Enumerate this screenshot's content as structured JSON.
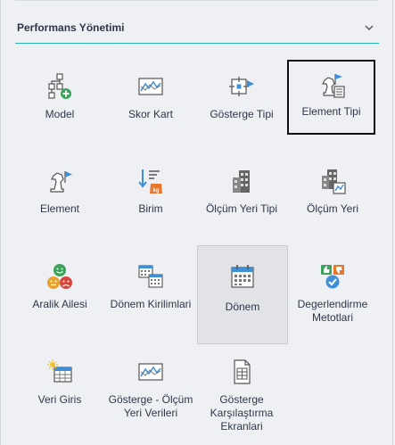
{
  "section": {
    "title": "Performans Yönetimi",
    "expand_icon": "chevron-down-icon"
  },
  "tiles": [
    {
      "label": "Model",
      "icon": "model-hierarchy-icon"
    },
    {
      "label": "Skor Kart",
      "icon": "scorecard-chart-icon"
    },
    {
      "label": "Gösterge Tipi",
      "icon": "indicator-type-icon"
    },
    {
      "label": "Element Tipi",
      "icon": "element-type-icon"
    },
    {
      "label": "Element",
      "icon": "chess-knight-flag-icon"
    },
    {
      "label": "Birim",
      "icon": "unit-kg-sort-icon"
    },
    {
      "label": "Ölçüm Yeri Tipi",
      "icon": "building-icon"
    },
    {
      "label": "Ölçüm Yeri",
      "icon": "building-chart-icon"
    },
    {
      "label": "Aralik Ailesi",
      "icon": "smileys-icon"
    },
    {
      "label": "Dönem Kirilimlari",
      "icon": "calendar-grid-icon"
    },
    {
      "label": "Dönem",
      "icon": "calendar-icon"
    },
    {
      "label": "Degerlendirme Metotlari",
      "icon": "thumbs-check-icon"
    },
    {
      "label": "Veri Giris",
      "icon": "data-entry-sun-icon"
    },
    {
      "label": "Gösterge - Ölçüm Yeri Verileri",
      "icon": "chart-data-icon"
    },
    {
      "label": "Gösterge Karşılaştırma Ekranlari",
      "icon": "document-compare-icon"
    }
  ],
  "colors": {
    "accent_line": "#27b5b0",
    "icon_blue": "#3e8fd6",
    "icon_green": "#3ba35a",
    "icon_orange": "#e8772e"
  }
}
